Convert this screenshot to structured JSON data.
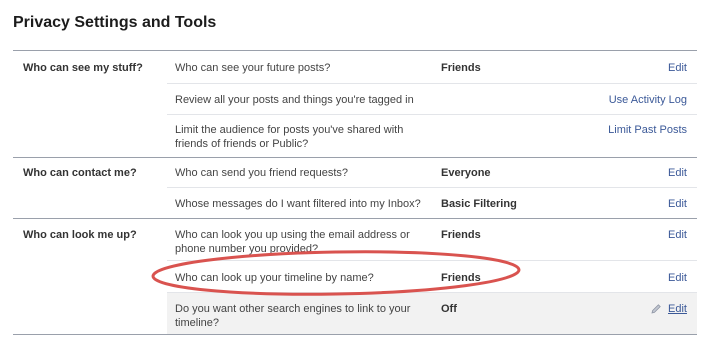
{
  "page": {
    "title": "Privacy Settings and Tools"
  },
  "sections": [
    {
      "label": "Who can see my stuff?",
      "rows": [
        {
          "question": "Who can see your future posts?",
          "value": "Friends",
          "action": "Edit"
        },
        {
          "question": "Review all your posts and things you're tagged in",
          "value": "",
          "action": "Use Activity Log"
        },
        {
          "question": "Limit the audience for posts you've shared with friends of friends or Public?",
          "value": "",
          "action": "Limit Past Posts"
        }
      ]
    },
    {
      "label": "Who can contact me?",
      "rows": [
        {
          "question": "Who can send you friend requests?",
          "value": "Everyone",
          "action": "Edit"
        },
        {
          "question": "Whose messages do I want filtered into my Inbox?",
          "value": "Basic Filtering",
          "action": "Edit"
        }
      ]
    },
    {
      "label": "Who can look me up?",
      "rows": [
        {
          "question": "Who can look you up using the email address or phone number you provided?",
          "value": "Friends",
          "action": "Edit"
        },
        {
          "question": "Who can look up your timeline by name?",
          "value": "Friends",
          "action": "Edit"
        },
        {
          "question": "Do you want other search engines to link to your timeline?",
          "value": "Off",
          "action": "Edit"
        }
      ]
    }
  ],
  "colors": {
    "link": "#3b5998",
    "annotation": "#d9534f",
    "row_highlight": "#f2f2f2"
  },
  "icons": {
    "edit_hover": "pencil-icon"
  }
}
